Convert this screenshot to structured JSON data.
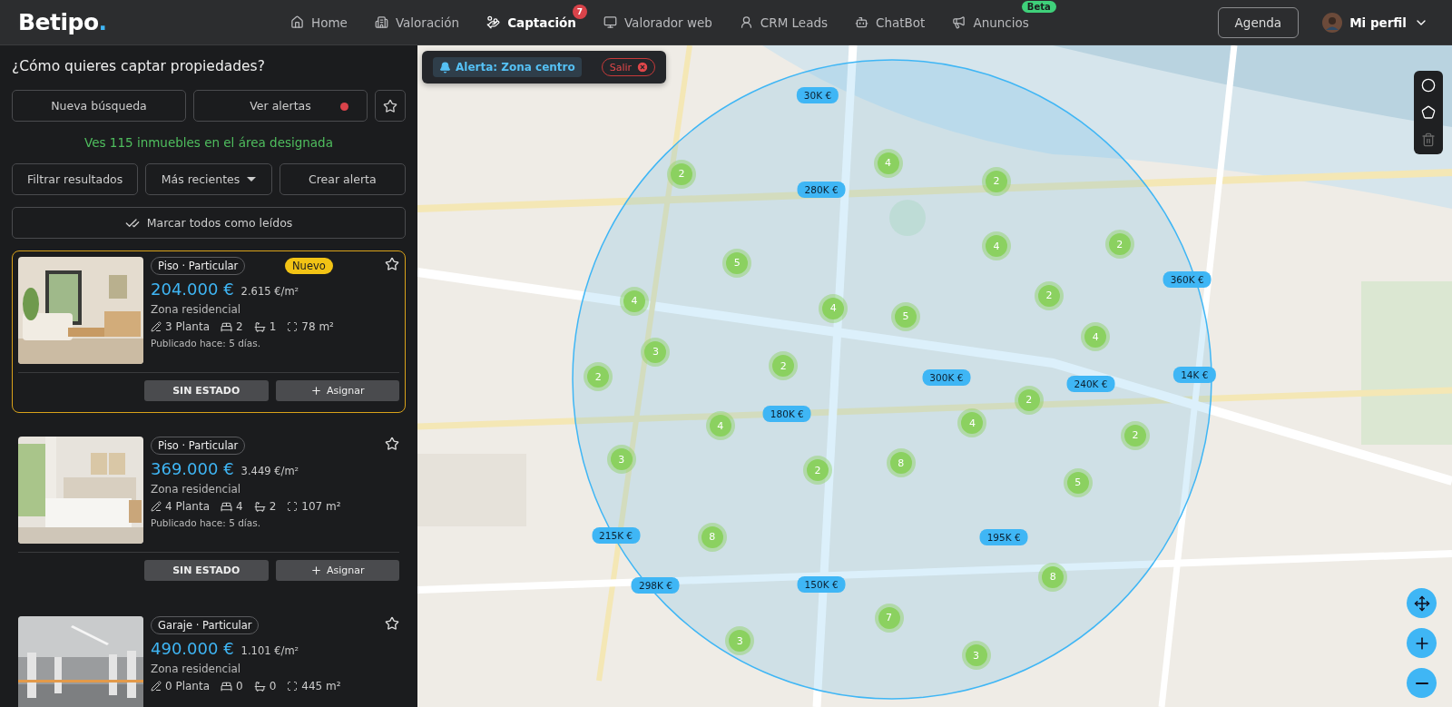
{
  "brand": {
    "name": "Betipo",
    "dot": "."
  },
  "nav": [
    {
      "label": "Home",
      "selected": false
    },
    {
      "label": "Valoración",
      "selected": false
    },
    {
      "label": "Captación",
      "selected": true,
      "badge": "7"
    },
    {
      "label": "Valorador web",
      "selected": false
    },
    {
      "label": "CRM Leads",
      "selected": false
    },
    {
      "label": "ChatBot",
      "selected": false
    },
    {
      "label": "Anuncios",
      "selected": false,
      "tag": "Beta"
    }
  ],
  "agenda": "Agenda",
  "profile": "Mi perfil",
  "panel": {
    "title": "¿Cómo quieres captar propiedades?",
    "new_search": "Nueva búsqueda",
    "alerts": {
      "label": "Ver alertas",
      "unread": true
    },
    "count": "Ves 115 inmuebles en el área designada",
    "filter": "Filtrar resultados",
    "sort": "Más recientes",
    "create_alert": "Crear alerta",
    "mark_read": "Marcar todos como leídos",
    "cards": [
      {
        "type": "Piso · Particular",
        "new": true,
        "badge": "Nuevo",
        "selected": true,
        "price": "204.000 €",
        "price_m2": "2.615 €/m²",
        "zone": "Zona residencial",
        "floor": "3 Planta",
        "beds": "2",
        "baths": "1",
        "area": "78 m²",
        "published": "Publicado hace: 5 días.",
        "status": "SIN ESTADO",
        "assign": "Asignar"
      },
      {
        "type": "Piso · Particular",
        "new": false,
        "selected": false,
        "price": "369.000 €",
        "price_m2": "3.449 €/m²",
        "zone": "Zona residencial",
        "floor": "4 Planta",
        "beds": "4",
        "baths": "2",
        "area": "107 m²",
        "published": "Publicado hace: 5 días.",
        "status": "SIN ESTADO",
        "assign": "Asignar"
      },
      {
        "type": "Garaje · Particular",
        "new": false,
        "selected": false,
        "price": "490.000 €",
        "price_m2": "1.101 €/m²",
        "zone": "Zona residencial",
        "floor": "0 Planta",
        "beds": "0",
        "baths": "0",
        "area": "445 m²"
      }
    ]
  },
  "map": {
    "alert": "Alerta: Zona centro",
    "exit": "Salir",
    "delete_disabled": true,
    "prices": [
      "30K €",
      "280K €",
      "360K €",
      "300K €",
      "240K €",
      "14K €",
      "180K €",
      "215K €",
      "195K €",
      "298K €",
      "150K €"
    ],
    "clusters": [
      "2",
      "4",
      "2",
      "4",
      "2",
      "5",
      "4",
      "4",
      "5",
      "2",
      "4",
      "3",
      "2",
      "2",
      "2",
      "4",
      "4",
      "2",
      "3",
      "8",
      "2",
      "5",
      "8",
      "8",
      "7",
      "3",
      "3"
    ]
  }
}
